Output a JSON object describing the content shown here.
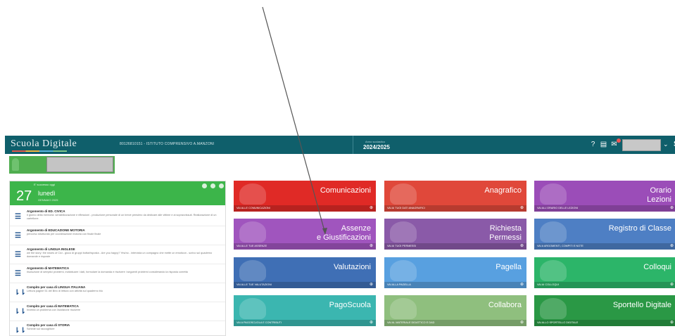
{
  "app": {
    "logo": "Scuola Digitale",
    "school": "80126810151 - ISTITUTO COMPRENSIVO A.MANZONI",
    "year_label": "Anno scolastico",
    "year": "2024/2025",
    "user_initial": "S"
  },
  "day_panel": {
    "greeting": "E' successo oggi",
    "day_number": "27",
    "weekday": "lunedì",
    "month_year": "GENNAIO 2025",
    "items": [
      {
        "icon": "list-icon",
        "title": "Argomento di ED. CIVICA",
        "detail": "Il giorno della memoria: sensibilizzazione e riflessioni - produzione personale di un breve pensiero da dedicare alle vittime e ai sopravvissuti. Realizzazione di un cartellone."
      },
      {
        "icon": "list-icon",
        "title": "Argomento di EDUCAZIONE MOTORIA",
        "detail": "percorso strutturato per coordinazione motoria con finale finale"
      },
      {
        "icon": "list-icon",
        "title": "Argomento di LINGUA INGLESE",
        "detail": "we the story: the shoes of Cici - gioco di gruppi botta/risposta - Are you happy? Yes/no - intervista un compagno che mette un emoticon - scrivo sul quaderno domande e risposte"
      },
      {
        "icon": "list-icon",
        "title": "Argomento di MATEMATICA",
        "detail": "risoluzione di semplici problemi, individuare i dati, formulare la domanda e risolvere i seguenti problemi considerando la risposta corretta"
      },
      {
        "icon": "homework-icon",
        "title": "Compito per casa di LINGUA ITALIANA",
        "detail": "Lettura pagine 51 del libro di lettura con attività sul quaderno blu"
      },
      {
        "icon": "homework-icon",
        "title": "Compito per casa di MATEMATICA",
        "detail": "Inventa un problema con l'addizione risolvere"
      },
      {
        "icon": "homework-icon",
        "title": "Compito per casa di STORIA",
        "detail": "Schede sul raccoglitore"
      }
    ]
  },
  "tiles": [
    {
      "label": "Comunicazioni",
      "footer": "VAI ALLE COMUNICAZIONI",
      "color": "#e02a26"
    },
    {
      "label": "Anagrafico",
      "footer": "VAI AI TUOI DATI ANAGRAFICI",
      "color": "#e0483a"
    },
    {
      "label": "Orario\nLezioni",
      "footer": "VAI ALL'ORARIO DELLE LEZIONI",
      "color": "#9b4db8"
    },
    {
      "label": "Assenze\ne Giustificazioni",
      "footer": "VAI ALLE TUE ASSENZE",
      "color": "#a055be"
    },
    {
      "label": "Richiesta\nPermessi",
      "footer": "VAI AI TUOI PERMESSI",
      "color": "#8a5aa8"
    },
    {
      "label": "Registro di Classe",
      "footer": "VAI A ARGOMENTI, COMPITI E NOTE",
      "color": "#4e7fc4"
    },
    {
      "label": "Valutazioni",
      "footer": "VAI ALLE TUE VALUTAZIONI",
      "color": "#3f6fb5"
    },
    {
      "label": "Pagella",
      "footer": "VAI ALLA PAGELLA",
      "color": "#58a0e0"
    },
    {
      "label": "Colloqui",
      "footer": "VAI AI COLLOQUI",
      "color": "#2cb569"
    },
    {
      "label": "PagoScuola",
      "footer": "VAI A PAGOSCUOLA E CONTRIBUTI",
      "color": "#3bb6b0"
    },
    {
      "label": "Collabora",
      "footer": "VAI AL MATERIALE DIDATTICO E DAD",
      "color": "#8fbf7e"
    },
    {
      "label": "Sportello Digitale",
      "footer": "VAI ALLO SPORTELLO DIGITALE",
      "color": "#2a9845"
    }
  ]
}
